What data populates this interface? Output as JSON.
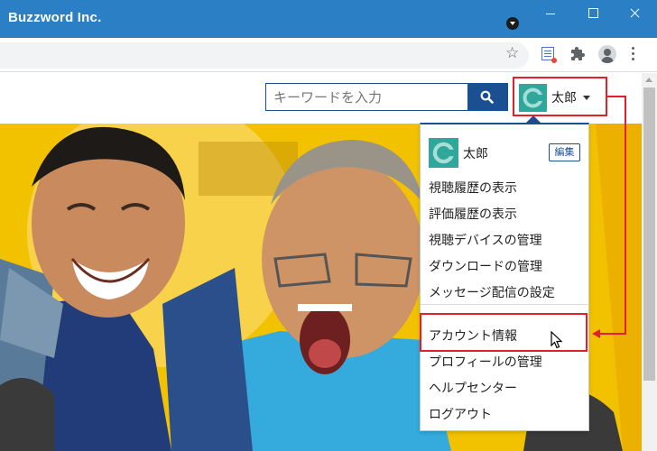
{
  "window": {
    "title": "Buzzword Inc."
  },
  "browser": {
    "toolbar_icons": [
      "star-icon",
      "extension-list-icon",
      "puzzle-icon",
      "profile-icon",
      "more-vertical-icon"
    ]
  },
  "header": {
    "search": {
      "placeholder": "キーワードを入力",
      "button_icon": "search-icon"
    },
    "user": {
      "name": "太郎",
      "avatar_icon": "avatar-c-icon"
    }
  },
  "dropdown": {
    "user_name": "太郎",
    "edit_label": "編集",
    "items": [
      {
        "label": "視聴履歴の表示"
      },
      {
        "label": "評価履歴の表示"
      },
      {
        "label": "視聴デバイスの管理"
      },
      {
        "label": "ダウンロードの管理"
      },
      {
        "label": "メッセージ配信の設定"
      }
    ],
    "items2": [
      {
        "label": "アカウント情報"
      },
      {
        "label": "プロフィールの管理"
      },
      {
        "label": "ヘルプセンター"
      },
      {
        "label": "ログアウト"
      }
    ]
  },
  "colors": {
    "titlebar": "#2b7fc5",
    "accent": "#1a4f91",
    "avatar": "#2fa79a",
    "annotation": "#e0202b",
    "hero_background": "#f2c200"
  }
}
